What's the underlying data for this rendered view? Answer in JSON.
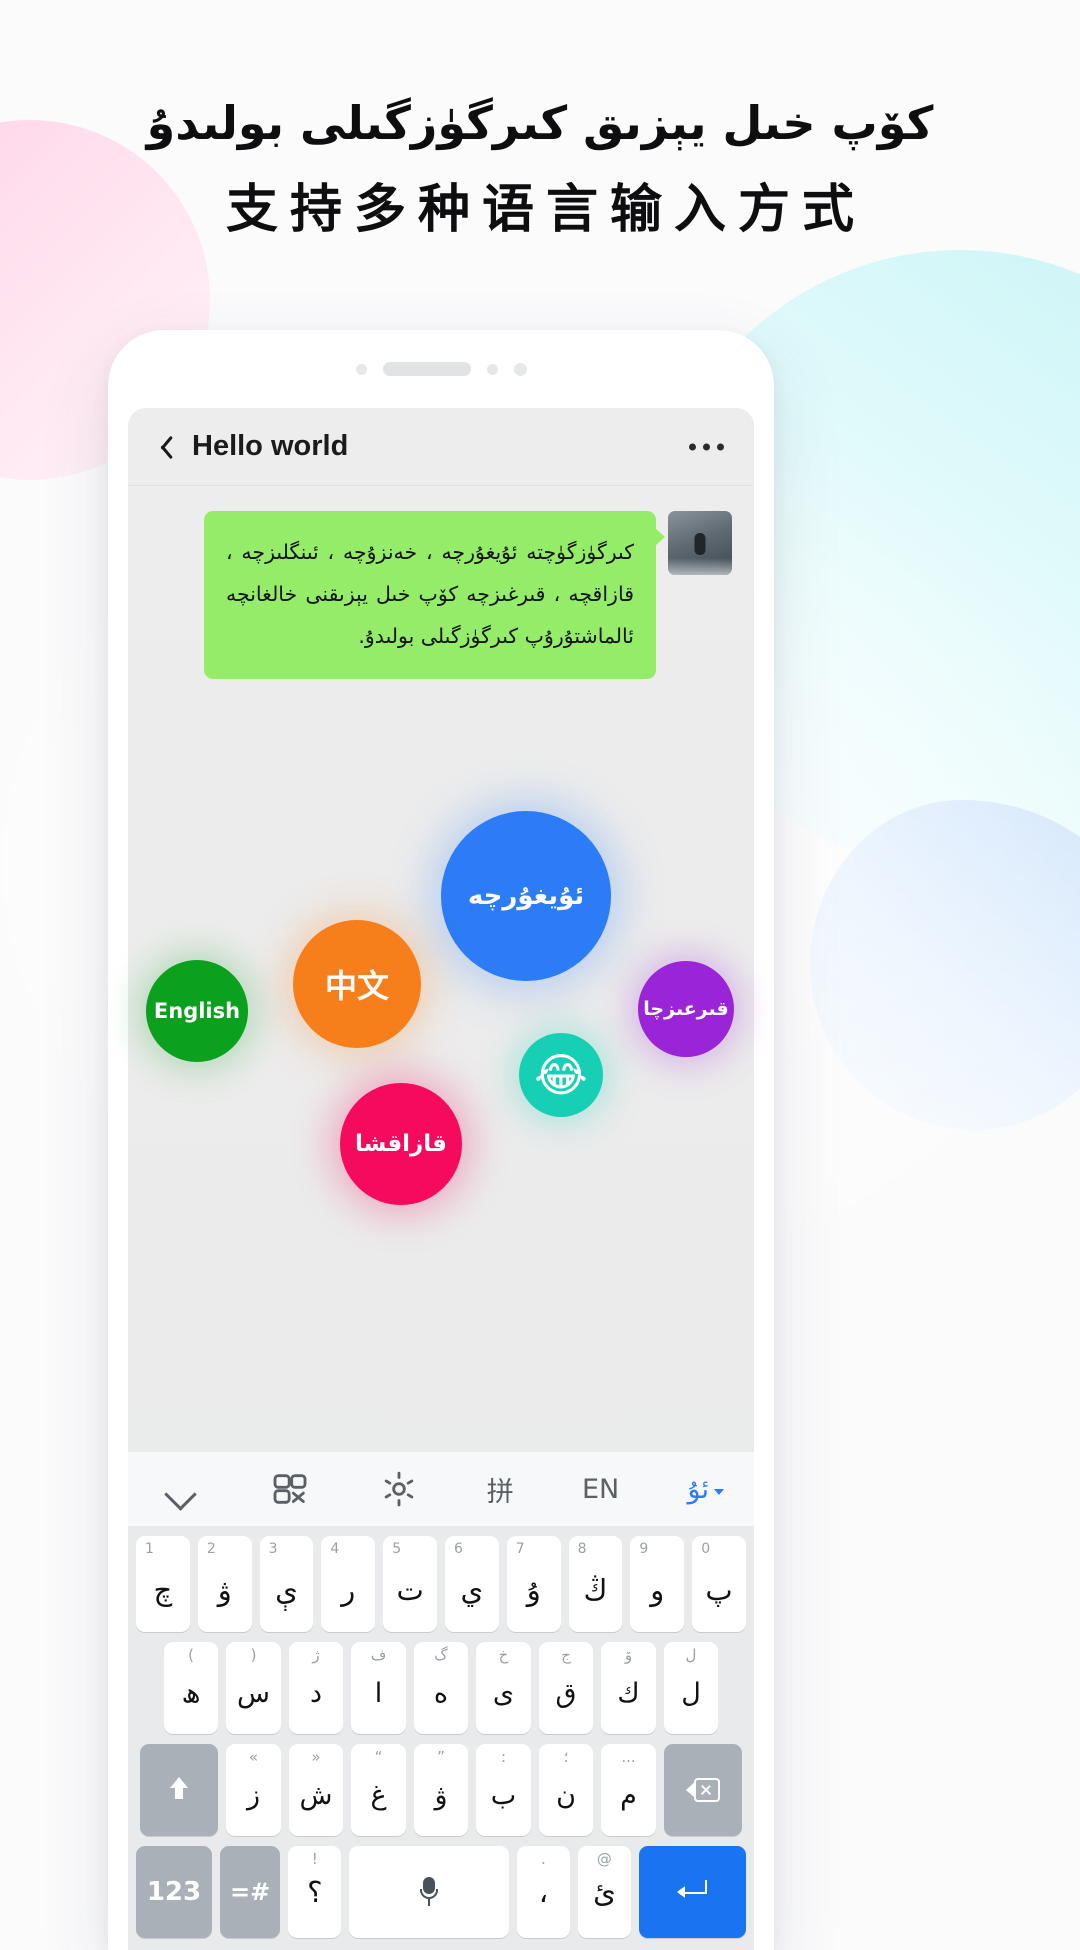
{
  "headline": {
    "uyghur": "كۆپ خىل يېزىق كىرگۈزگىلى بولىدۇ",
    "chinese": "支持多种语言输入方式"
  },
  "phone": {
    "chat": {
      "title": "Hello world",
      "back_icon": "back-chevron-icon",
      "more_icon": "more-options-icon",
      "message": "كىرگۈزگۈچتە    ئۇيغۇرچە ،    خەنزۇچە ، ئىنگلىزچە ، قازاقچە ، قىرغىزچە كۆپ خىل يېزىقنى خالغانچە ئالماشتۇرۇپ كىرگۈزگىلى بولىدۇ.",
      "avatar": "contact-avatar"
    },
    "bubbles": [
      {
        "id": "uyghur",
        "label": "ئۇيغۇرچە",
        "color": "#2b7cf6"
      },
      {
        "id": "chinese",
        "label": "中文",
        "color": "#f77f1b"
      },
      {
        "id": "english",
        "label": "English",
        "color": "#0ba01e"
      },
      {
        "id": "kyrgyz",
        "label": "قىرعىزچا",
        "color": "#9a24d8"
      },
      {
        "id": "emoji",
        "label": "😂",
        "color": "#17cfb4"
      },
      {
        "id": "kazakh",
        "label": "قازاقشا",
        "color": "#f50a5d"
      }
    ],
    "keyboard": {
      "toolbar": {
        "collapse": "chevron-down-icon",
        "clipboard": "clipboard-icon",
        "settings": "gear-icon",
        "lang_pinyin": "拼",
        "lang_english": "EN",
        "lang_uyghur": "ئۇ"
      },
      "row1": [
        {
          "num": "1",
          "glyph": "چ"
        },
        {
          "num": "2",
          "glyph": "ۋ"
        },
        {
          "num": "3",
          "glyph": "ې"
        },
        {
          "num": "4",
          "glyph": "ر"
        },
        {
          "num": "5",
          "glyph": "ت"
        },
        {
          "num": "6",
          "glyph": "ي"
        },
        {
          "num": "7",
          "glyph": "ۇ"
        },
        {
          "num": "8",
          "glyph": "ڭ"
        },
        {
          "num": "9",
          "glyph": "و"
        },
        {
          "num": "0",
          "glyph": "پ"
        }
      ],
      "row2": [
        {
          "sup": "(",
          "glyph": "ھ"
        },
        {
          "sup": ")",
          "glyph": "س"
        },
        {
          "sup": "ژ",
          "glyph": "د"
        },
        {
          "sup": "ف",
          "glyph": "ا"
        },
        {
          "sup": "گ",
          "glyph": "ە"
        },
        {
          "sup": "خ",
          "glyph": "ى"
        },
        {
          "sup": "ج",
          "glyph": "ق"
        },
        {
          "sup": "ۆ",
          "glyph": "ك"
        },
        {
          "sup": "ل",
          "glyph": "ل"
        }
      ],
      "row3": {
        "shift": "shift-key",
        "keys": [
          {
            "sup": "«",
            "glyph": "ز"
          },
          {
            "sup": "»",
            "glyph": "ش"
          },
          {
            "sup": "“",
            "glyph": "غ"
          },
          {
            "sup": "”",
            "glyph": "ۋ"
          },
          {
            "sup": ":",
            "glyph": "ب"
          },
          {
            "sup": "؛",
            "glyph": "ن"
          },
          {
            "sup": "...",
            "glyph": "م"
          }
        ],
        "backspace": "backspace-key"
      },
      "row4": {
        "numeric": "123",
        "symbols": "=#",
        "question": "؟",
        "question_sup": "!",
        "space": "microphone-icon",
        "comma": "،",
        "comma_sup": ".",
        "hamza": "ئ",
        "hamza_sup": "@",
        "enter": "enter-icon"
      }
    }
  }
}
